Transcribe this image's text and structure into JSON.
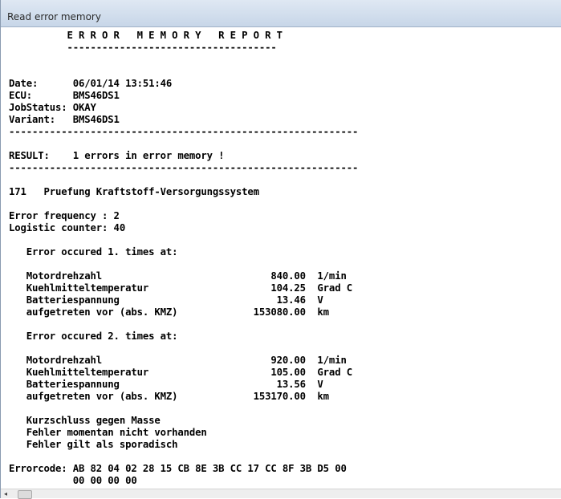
{
  "window": {
    "title": "Read error memory"
  },
  "report": {
    "lines": [
      "          E R R O R   M E M O R Y   R E P O R T",
      "          ------------------------------------",
      "",
      "",
      "Date:      06/01/14 13:51:46",
      "ECU:       BMS46DS1",
      "JobStatus: OKAY",
      "Variant:   BMS46DS1",
      "------------------------------------------------------------",
      "",
      "RESULT:    1 errors in error memory !",
      "------------------------------------------------------------",
      "",
      "171   Pruefung Kraftstoff-Versorgungssystem",
      "",
      "Error frequency : 2",
      "Logistic counter: 40",
      "",
      "   Error occured 1. times at:",
      "",
      "   Motordrehzahl                             840.00  1/min",
      "   Kuehlmitteltemperatur                     104.25  Grad C",
      "   Batteriespannung                           13.46  V",
      "   aufgetreten vor (abs. KMZ)             153080.00  km",
      "",
      "   Error occured 2. times at:",
      "",
      "   Motordrehzahl                             920.00  1/min",
      "   Kuehlmitteltemperatur                     105.00  Grad C",
      "   Batteriespannung                           13.56  V",
      "   aufgetreten vor (abs. KMZ)             153170.00  km",
      "",
      "   Kurzschluss gegen Masse",
      "   Fehler momentan nicht vorhanden",
      "   Fehler gilt als sporadisch",
      "",
      "Errorcode: AB 82 04 02 28 15 CB 8E 3B CC 17 CC 8F 3B D5 00",
      "           00 00 00 00",
      "============================================================"
    ]
  },
  "scrollbar": {
    "left_arrow": "◂"
  }
}
